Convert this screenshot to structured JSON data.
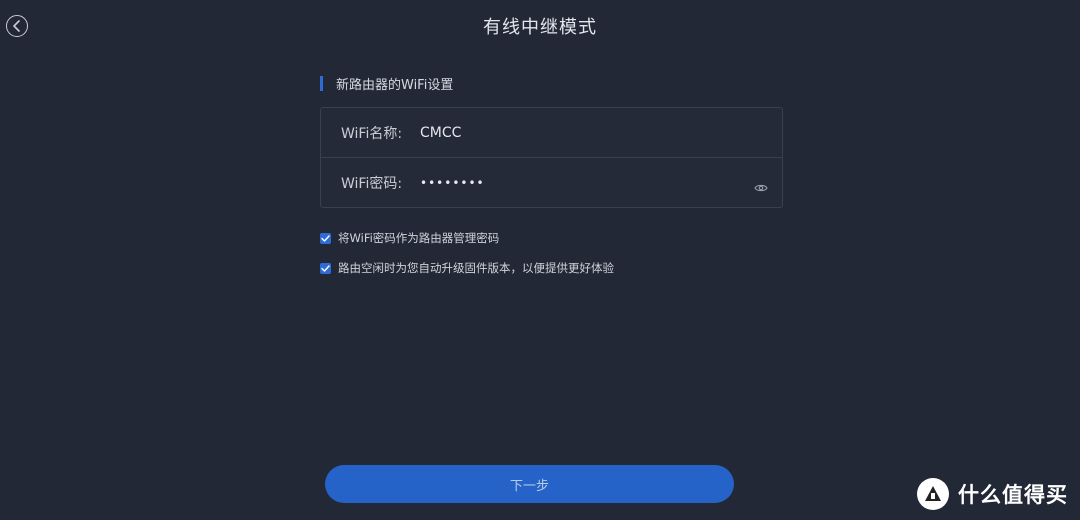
{
  "header": {
    "title": "有线中继模式",
    "back_icon": "back-arrow-circle-icon"
  },
  "section": {
    "title": "新路由器的WiFi设置"
  },
  "form": {
    "ssid_label": "WiFi名称:",
    "ssid_value": "CMCC",
    "password_label": "WiFi密码:",
    "password_value": "••••••••",
    "eye_icon": "eye-icon"
  },
  "options": [
    {
      "label": "将WiFi密码作为路由器管理密码",
      "checked": true
    },
    {
      "label": "路由空闲时为您自动升级固件版本，以便提供更好体验",
      "checked": true
    }
  ],
  "footer": {
    "next_label": "下一步"
  },
  "watermark": {
    "logo_char": "值",
    "text": "什么值得买"
  },
  "colors": {
    "background": "#232837",
    "accent": "#2f6bd6",
    "button": "#2563c8"
  }
}
